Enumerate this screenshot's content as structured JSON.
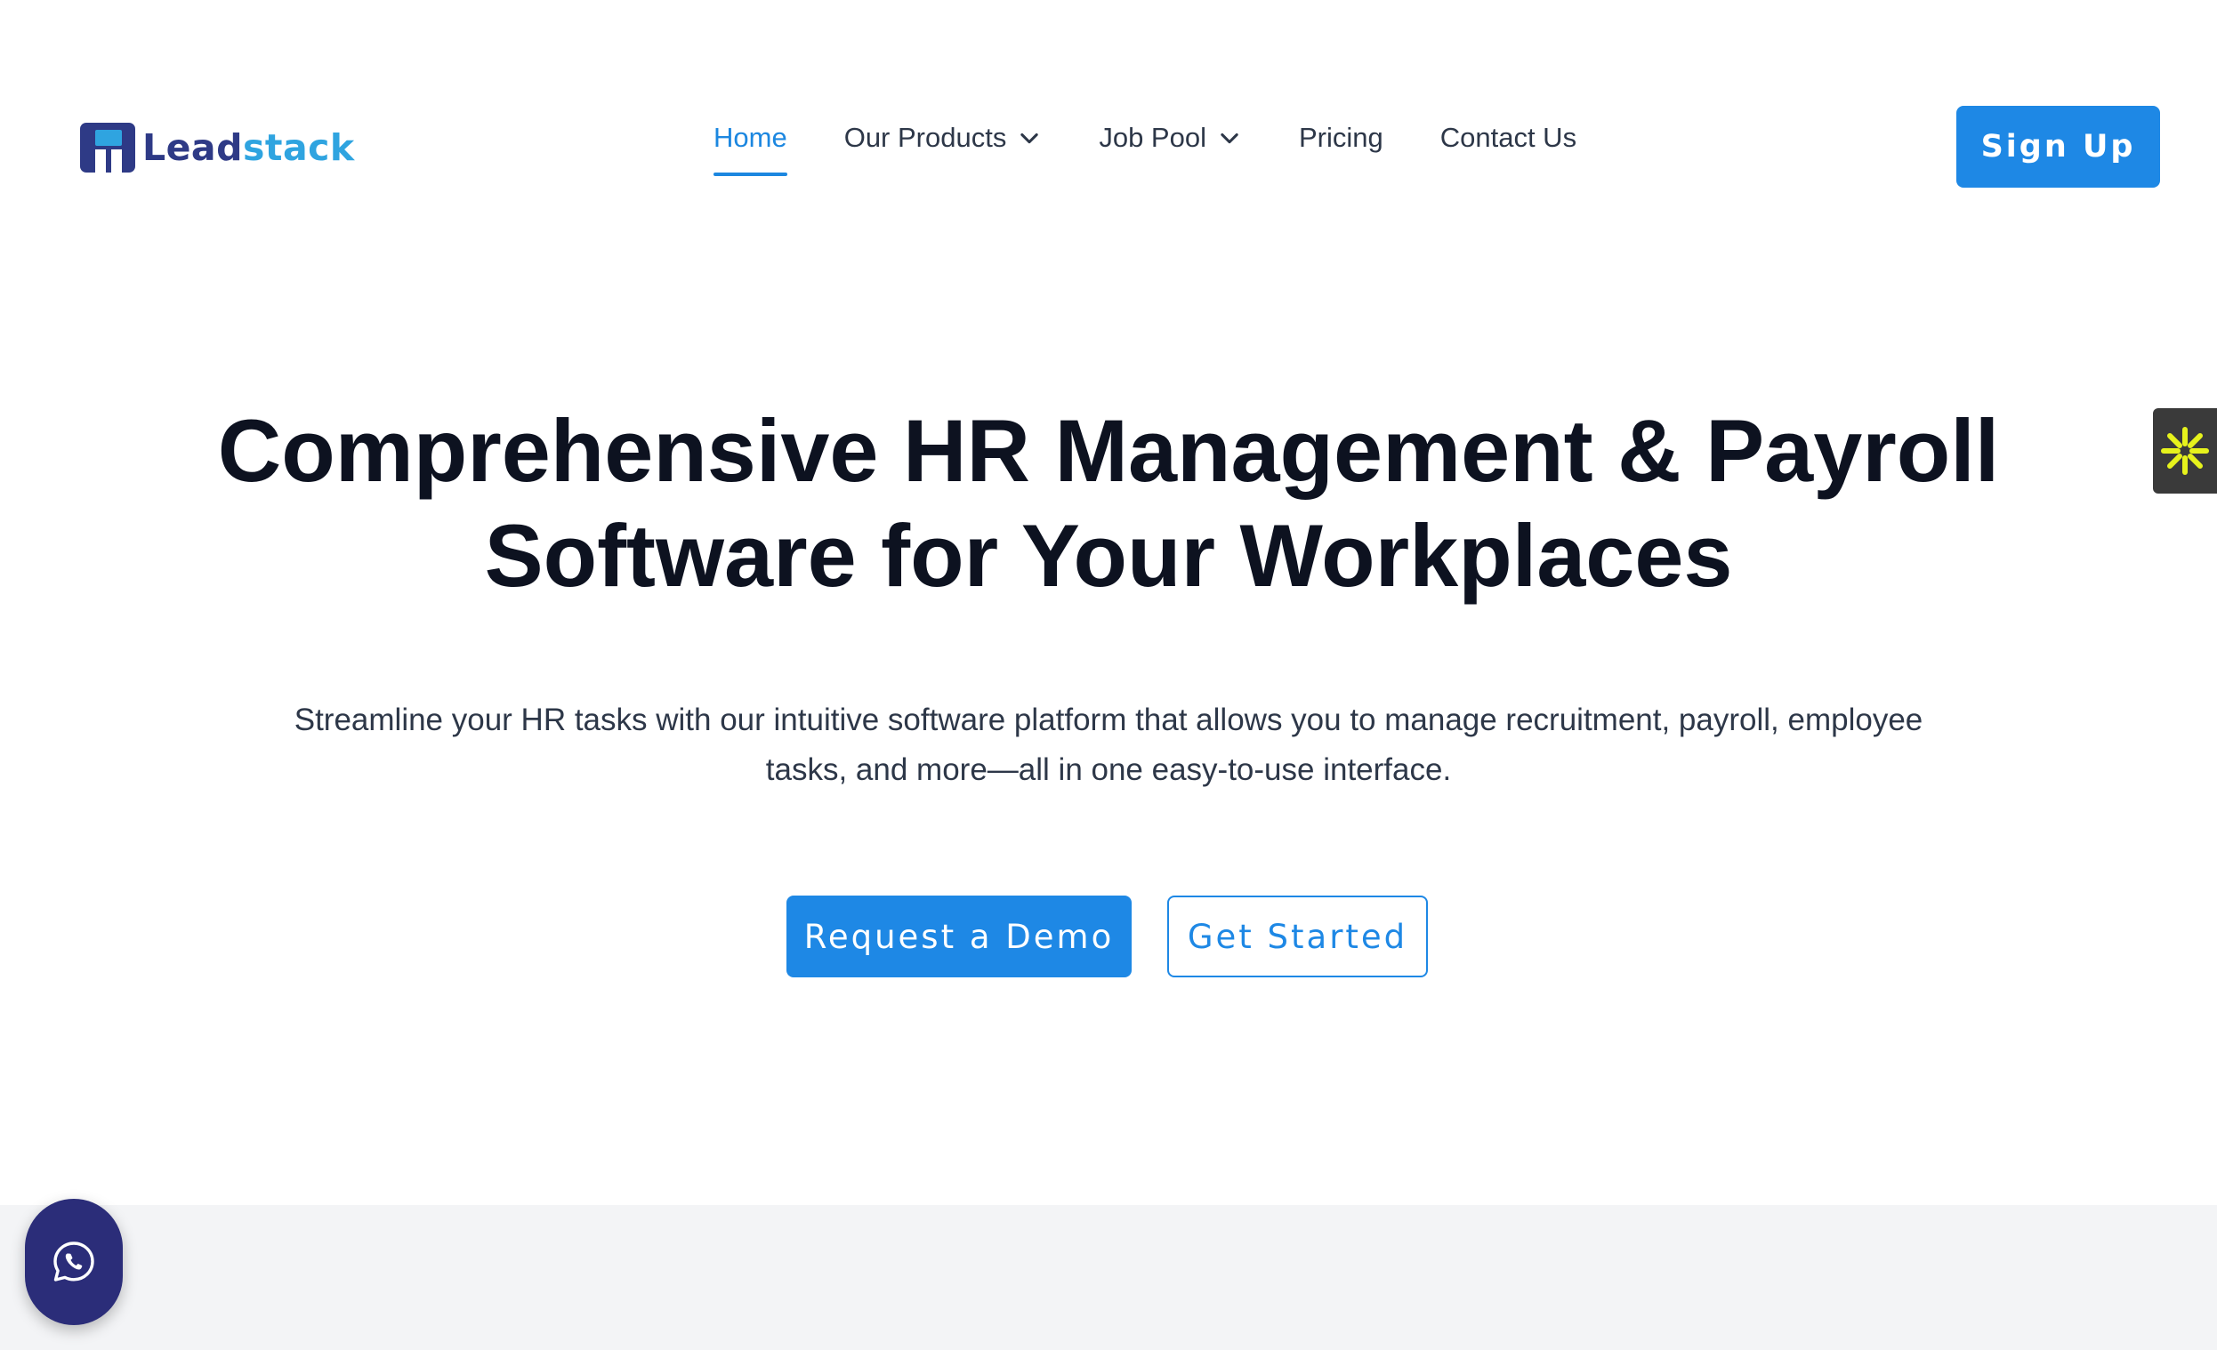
{
  "brand": {
    "name_part1": "Lead",
    "name_part2": "stack",
    "colors": {
      "dark": "#2e3a86",
      "light": "#2fa4e0"
    }
  },
  "nav": {
    "items": [
      {
        "label": "Home",
        "active": true
      },
      {
        "label": "Our Products",
        "dropdown": true
      },
      {
        "label": "Job Pool",
        "dropdown": true
      },
      {
        "label": "Pricing"
      },
      {
        "label": "Contact Us"
      }
    ]
  },
  "header": {
    "signup_label": "Sign Up"
  },
  "hero": {
    "title_line1": "Comprehensive HR Management & Payroll",
    "title_line2": "Software for Your Workplaces",
    "subtitle_line1": "Streamline your HR tasks with our intuitive software platform that allows you to manage recruitment, payroll, employee",
    "subtitle_line2": "tasks, and more—all in one easy-to-use interface.",
    "primary_cta": "Request a Demo",
    "secondary_cta": "Get Started"
  },
  "icons": {
    "side_widget": "asterisk-icon",
    "chat": "whatsapp-icon",
    "dropdown": "chevron-down-icon"
  },
  "colors": {
    "accent": "#1e88e5",
    "text_dark": "#0d1220",
    "band_bg": "#f3f4f6",
    "chat_bg": "#2b2d79",
    "widget_star": "#e6f21c"
  }
}
